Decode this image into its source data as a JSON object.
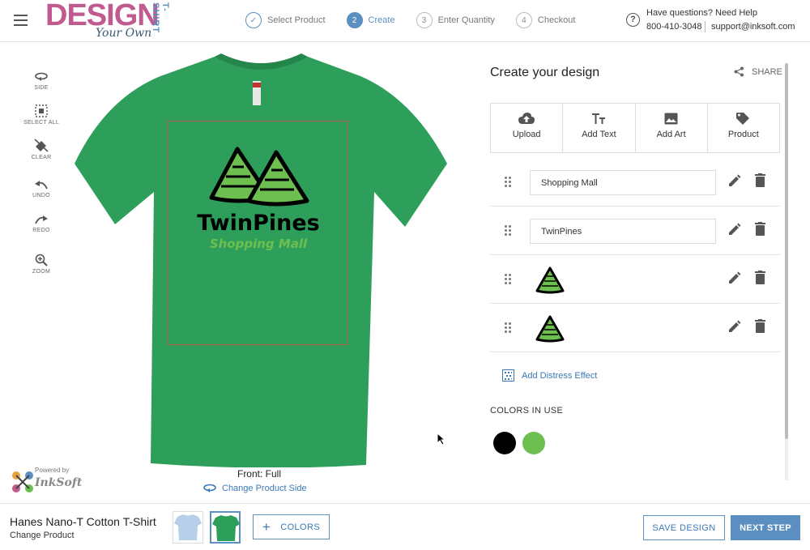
{
  "header": {
    "logo_main": "DESIGN",
    "logo_script": "Your Own",
    "logo_side": "T-SHIRT",
    "steps": [
      {
        "number": "",
        "label": "Select Product",
        "state": "done"
      },
      {
        "number": "2",
        "label": "Create",
        "state": "active"
      },
      {
        "number": "3",
        "label": "Enter Quantity",
        "state": "pending"
      },
      {
        "number": "4",
        "label": "Checkout",
        "state": "pending"
      }
    ],
    "help_title": "Have questions? Need Help",
    "help_phone": "800-410-3048",
    "help_email": "support@inksoft.com"
  },
  "toolbar": {
    "side": "SIDE",
    "select_all": "SELECT ALL",
    "clear": "CLEAR",
    "undo": "UNDO",
    "redo": "REDO",
    "zoom": "ZOOM"
  },
  "canvas": {
    "product_color": "#2e9e5b",
    "design_title": "TwinPines",
    "design_subtitle": "Shopping Mall",
    "side_label": "Front: Full",
    "change_side": "Change Product Side",
    "powered_by": "Powered by",
    "powered_brand": "InkSoft"
  },
  "panel": {
    "title": "Create your design",
    "share": "SHARE",
    "actions": [
      {
        "label": "Upload",
        "icon": "cloud-upload-icon"
      },
      {
        "label": "Add Text",
        "icon": "text-icon"
      },
      {
        "label": "Add Art",
        "icon": "image-icon"
      },
      {
        "label": "Product",
        "icon": "tag-icon"
      }
    ],
    "layers": [
      {
        "type": "text",
        "value": "Shopping Mall"
      },
      {
        "type": "text",
        "value": "TwinPines"
      },
      {
        "type": "art",
        "icon": "pine-tree-icon"
      },
      {
        "type": "art",
        "icon": "pine-tree-icon"
      }
    ],
    "distress": "Add Distress Effect",
    "colors_title": "COLORS IN USE",
    "colors": [
      "#000000",
      "#6dbf4f"
    ]
  },
  "footer": {
    "product_name": "Hanes Nano-T Cotton T-Shirt",
    "change_product": "Change Product",
    "colors_button": "COLORS",
    "save_button": "SAVE DESIGN",
    "next_button": "NEXT STEP"
  }
}
